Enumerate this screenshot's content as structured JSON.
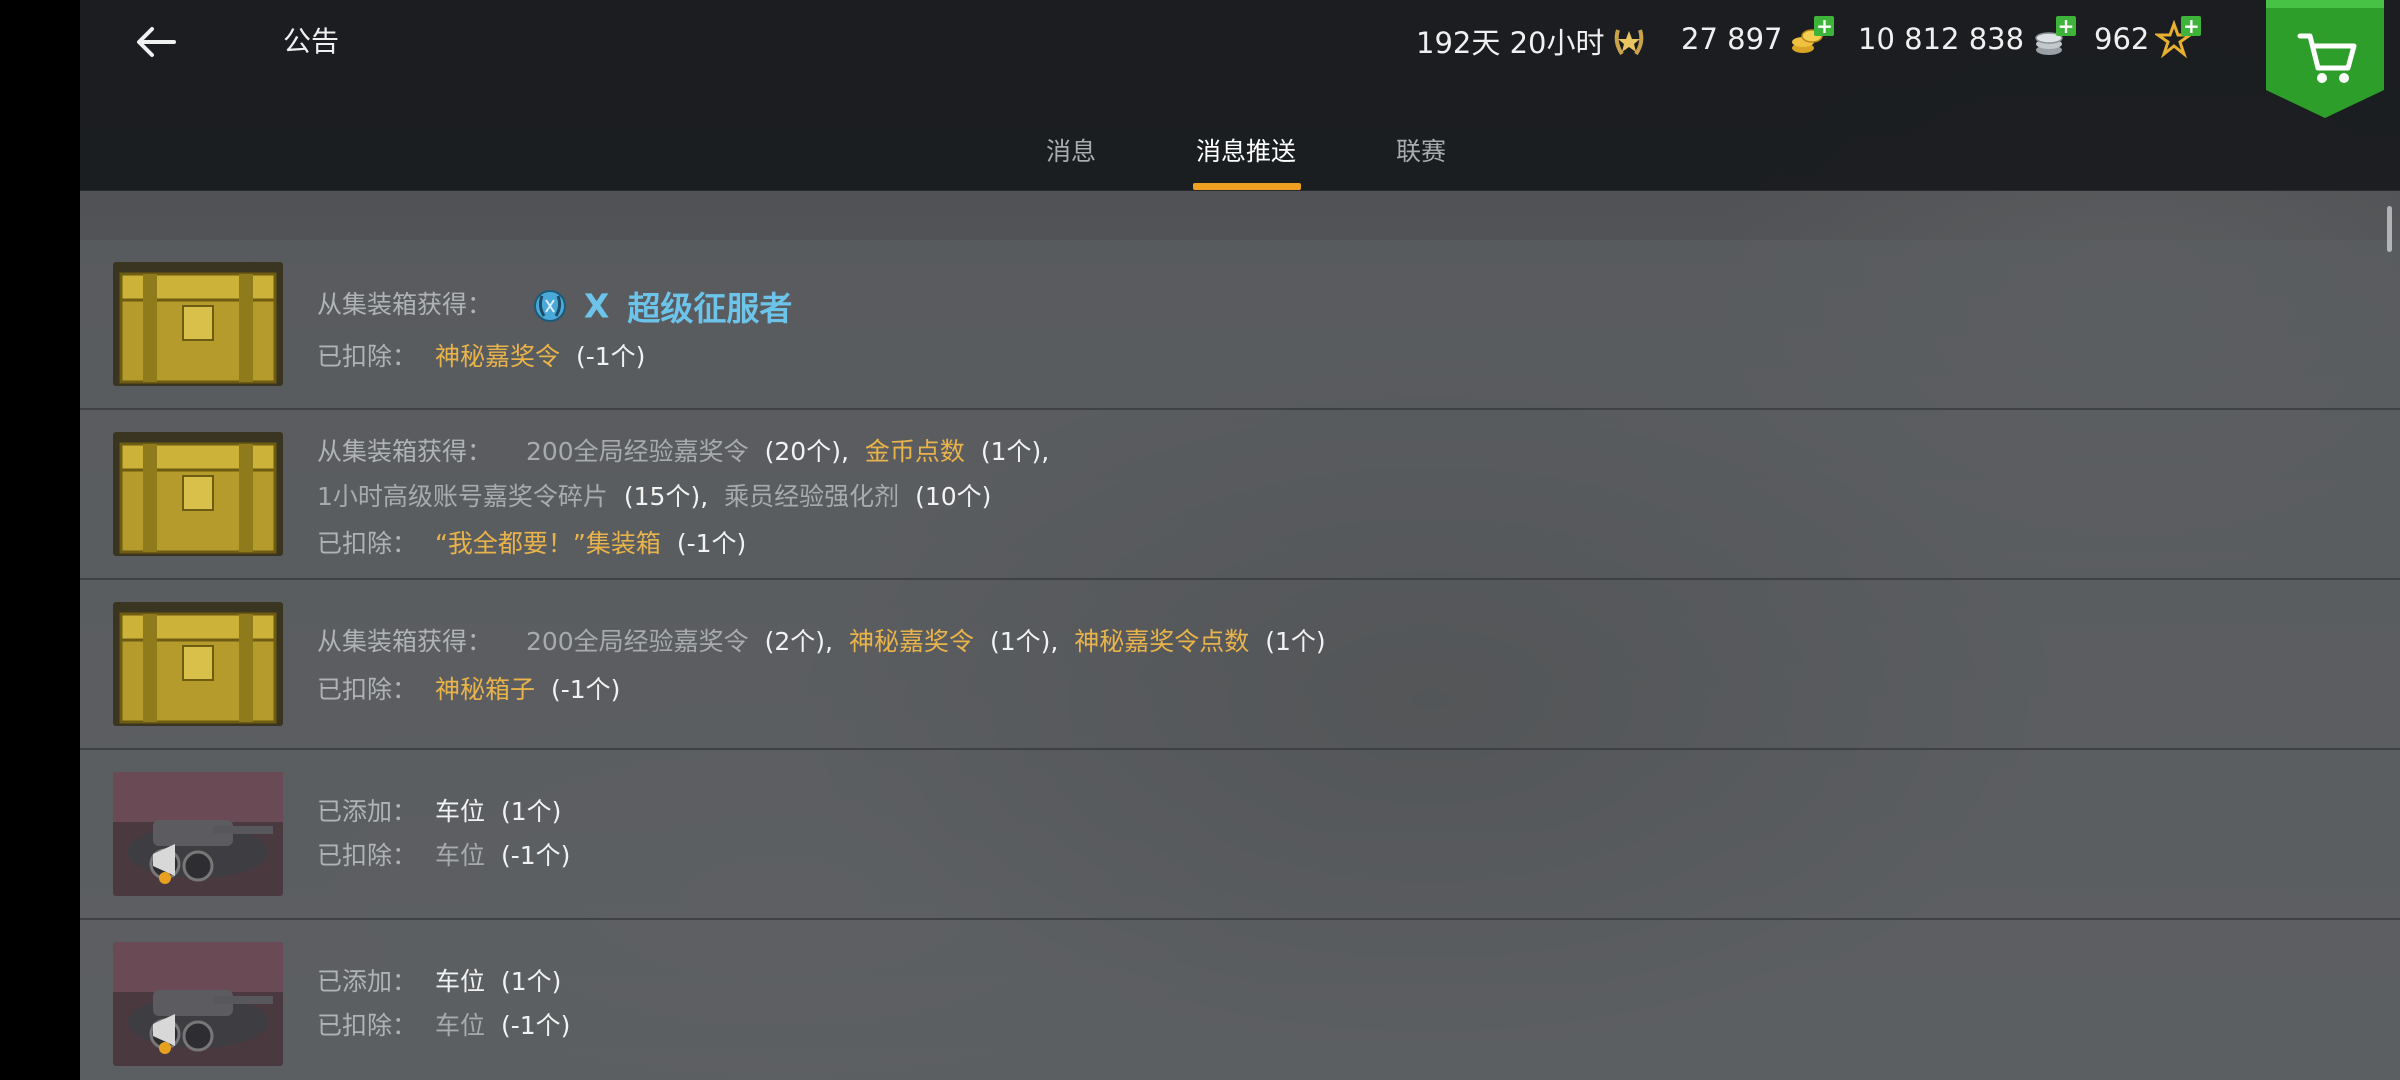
{
  "header": {
    "title": "公告",
    "premium_time": "192天 20小时",
    "gold": "27 897",
    "credits": "10 812 838",
    "free_xp": "962"
  },
  "tabs": [
    {
      "label": "消息",
      "active": false
    },
    {
      "label": "消息推送",
      "active": true
    },
    {
      "label": "联赛",
      "active": false
    }
  ],
  "messages": [
    {
      "lines": [
        {
          "label": "从集装箱获得：",
          "parts": [
            {
              "text": "X",
              "style": "rank"
            },
            {
              "text": "超级征服者",
              "style": "rank"
            }
          ]
        },
        {
          "label": "已扣除：",
          "parts": [
            {
              "text": "神秘嘉奖令",
              "style": "gold"
            },
            {
              "text": "(-1个)",
              "style": "paren"
            }
          ]
        }
      ]
    },
    {
      "lines": [
        {
          "label": "从集装箱获得：",
          "parts": [
            {
              "text": "200全局经验嘉奖令",
              "style": "gray"
            },
            {
              "text": "(20个),",
              "style": "paren"
            },
            {
              "text": "金币点数",
              "style": "gold"
            },
            {
              "text": "(1个),",
              "style": "paren"
            }
          ]
        },
        {
          "label": "",
          "parts": [
            {
              "text": "1小时高级账号嘉奖令碎片",
              "style": "gray"
            },
            {
              "text": "(15个),",
              "style": "paren"
            },
            {
              "text": "乘员经验强化剂",
              "style": "gray"
            },
            {
              "text": "(10个)",
              "style": "paren"
            }
          ]
        },
        {
          "label": "已扣除：",
          "parts": [
            {
              "text": "“我全都要！”集装箱",
              "style": "gold"
            },
            {
              "text": "(-1个)",
              "style": "paren"
            }
          ]
        }
      ]
    },
    {
      "lines": [
        {
          "label": "从集装箱获得：",
          "parts": [
            {
              "text": "200全局经验嘉奖令",
              "style": "gray"
            },
            {
              "text": "(2个),",
              "style": "paren"
            },
            {
              "text": "神秘嘉奖令",
              "style": "gold"
            },
            {
              "text": "(1个),",
              "style": "paren"
            },
            {
              "text": "神秘嘉奖令点数",
              "style": "gold"
            },
            {
              "text": "(1个)",
              "style": "paren"
            }
          ]
        },
        {
          "label": "已扣除：",
          "parts": [
            {
              "text": "神秘箱子",
              "style": "gold"
            },
            {
              "text": "(-1个)",
              "style": "paren"
            }
          ]
        }
      ]
    },
    {
      "lines": [
        {
          "label": "已添加：",
          "parts": [
            {
              "text": "车位",
              "style": "white"
            },
            {
              "text": "(1个)",
              "style": "paren"
            }
          ]
        },
        {
          "label": "已扣除：",
          "parts": [
            {
              "text": "车位",
              "style": "gray"
            },
            {
              "text": "(-1个)",
              "style": "paren"
            }
          ]
        }
      ]
    },
    {
      "lines": [
        {
          "label": "已添加：",
          "parts": [
            {
              "text": "车位",
              "style": "white"
            },
            {
              "text": "(1个)",
              "style": "paren"
            }
          ]
        },
        {
          "label": "已扣除：",
          "parts": [
            {
              "text": "车位",
              "style": "gray"
            },
            {
              "text": "(-1个)",
              "style": "paren"
            }
          ]
        }
      ]
    }
  ],
  "icons": {
    "back": "arrow-left-icon",
    "premium": "premium-laurel-icon",
    "gold": "gold-coins-icon",
    "credits": "silver-credits-icon",
    "free_xp": "star-xp-icon",
    "shop": "shopping-cart-icon",
    "container": "gold-container-icon",
    "garage_slot": "garage-slot-tank-icon",
    "rank_badge": "rank-laurel-badge-icon"
  },
  "colors": {
    "accent": "#f0a020",
    "gold_text": "#e9b34b",
    "rank_text": "#6cc4ea",
    "plus_green": "#3fb43a",
    "shop_green": "#2e9e2b"
  }
}
